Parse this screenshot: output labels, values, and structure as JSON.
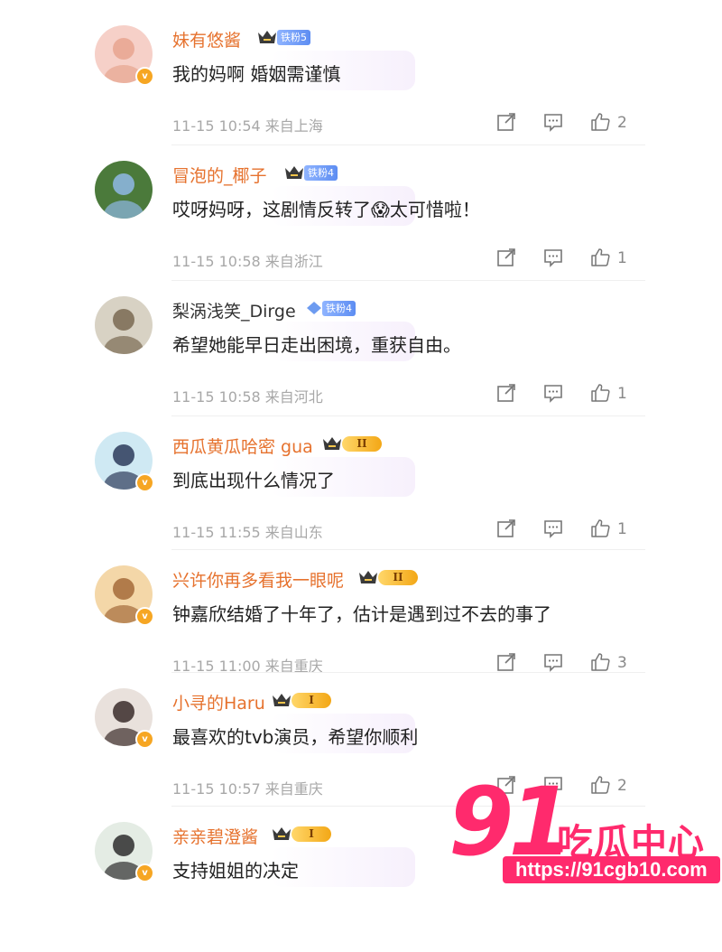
{
  "comments": [
    {
      "username": "妹有悠酱",
      "badge": "铁粉5",
      "badge_type": "fan",
      "crown": true,
      "verified": true,
      "text": "我的妈啊 婚姻需谨慎",
      "time": "11-15 10:54",
      "location": "来自上海",
      "likes": "2"
    },
    {
      "username": "冒泡的_椰子",
      "badge": "铁粉4",
      "badge_type": "fan",
      "crown": true,
      "verified": false,
      "text": "哎呀妈呀，这剧情反转了😱太可惜啦！",
      "time": "11-15 10:58",
      "location": "来自浙江",
      "likes": "1"
    },
    {
      "username": "梨涡浅笑_Dirge",
      "badge": "铁粉4",
      "badge_type": "fan",
      "crown": false,
      "verified": false,
      "text": "希望她能早日走出困境，重获自由。",
      "time": "11-15 10:58",
      "location": "来自河北",
      "likes": "1"
    },
    {
      "username": "西瓜黄瓜哈密 gua",
      "badge": "II",
      "badge_type": "vip",
      "crown": true,
      "verified": true,
      "text": "到底出现什么情况了",
      "time": "11-15 11:55",
      "location": "来自山东",
      "likes": "1"
    },
    {
      "username": "兴许你再多看我一眼呢",
      "badge": "II",
      "badge_type": "vip",
      "crown": true,
      "verified": true,
      "text": "钟嘉欣结婚了十年了，估计是遇到过不去的事了",
      "time": "11-15 11:00",
      "location": "来自重庆",
      "likes": "3"
    },
    {
      "username": "小寻的Haru",
      "badge": "I",
      "badge_type": "vip",
      "crown": true,
      "verified": true,
      "text": "最喜欢的tvb演员，希望你顺利",
      "time": "11-15 10:57",
      "location": "来自重庆",
      "likes": "2"
    },
    {
      "username": "亲亲碧澄酱",
      "badge": "I",
      "badge_type": "vip",
      "crown": true,
      "verified": true,
      "text": "支持姐姐的决定",
      "time": "",
      "location": "",
      "likes": ""
    }
  ],
  "icons": {
    "share": "share-icon",
    "comment": "comment-icon",
    "like": "like-icon",
    "verified": "verified-v-icon"
  },
  "colors": {
    "username": "#e6722e",
    "meta": "#a8a8a8",
    "watermark": "#ff2a6d"
  },
  "watermark": {
    "number": "91",
    "text": "吃瓜中心",
    "url": "https://91cgb10.com"
  }
}
